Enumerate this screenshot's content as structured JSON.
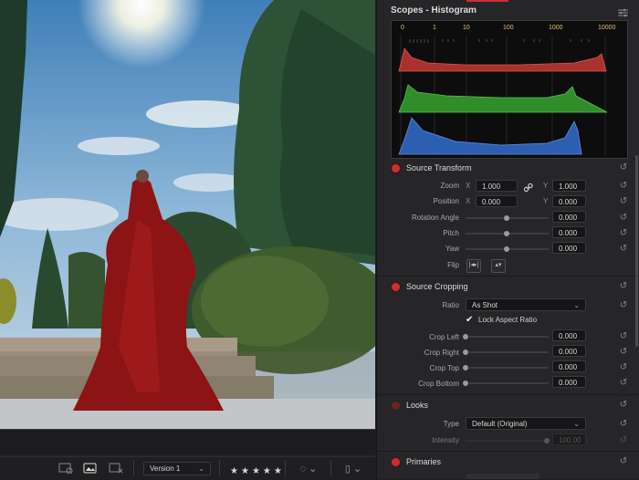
{
  "scopes": {
    "title": "Scopes - Histogram",
    "scale": [
      "0",
      "1",
      "10",
      "100",
      "1000",
      "10000"
    ],
    "channel_colors": {
      "red": "#c0443f",
      "green": "#3fa53a",
      "blue": "#3d6fc0"
    }
  },
  "source_transform": {
    "title": "Source Transform",
    "zoom_label": "Zoom",
    "x_label": "X",
    "y_label": "Y",
    "zoom_x": "1.000",
    "zoom_y": "1.000",
    "position_label": "Position",
    "position_x": "0.000",
    "position_y": "0.000",
    "rotation_label": "Rotation Angle",
    "rotation": "0.000",
    "pitch_label": "Pitch",
    "pitch": "0.000",
    "yaw_label": "Yaw",
    "yaw": "0.000",
    "flip_label": "Flip"
  },
  "source_cropping": {
    "title": "Source Cropping",
    "ratio_label": "Ratio",
    "ratio_value": "As Shot",
    "lock_label": "Lock Aspect Ratio",
    "lock_checked": true,
    "crop_left_label": "Crop Left",
    "crop_left": "0.000",
    "crop_right_label": "Crop Right",
    "crop_right": "0.000",
    "crop_top_label": "Crop Top",
    "crop_top": "0.000",
    "crop_bottom_label": "Crop Bottom",
    "crop_bottom": "0.000"
  },
  "looks": {
    "title": "Looks",
    "type_label": "Type",
    "type_value": "Default (Original)",
    "intensity_label": "Intensity",
    "intensity_value": "100.00"
  },
  "primaries": {
    "title": "Primaries"
  },
  "bottom_bar": {
    "version": "Version 1",
    "rating_stars": 5
  },
  "colors": {
    "accent_red": "#c8312f",
    "panel_bg": "#262629"
  }
}
